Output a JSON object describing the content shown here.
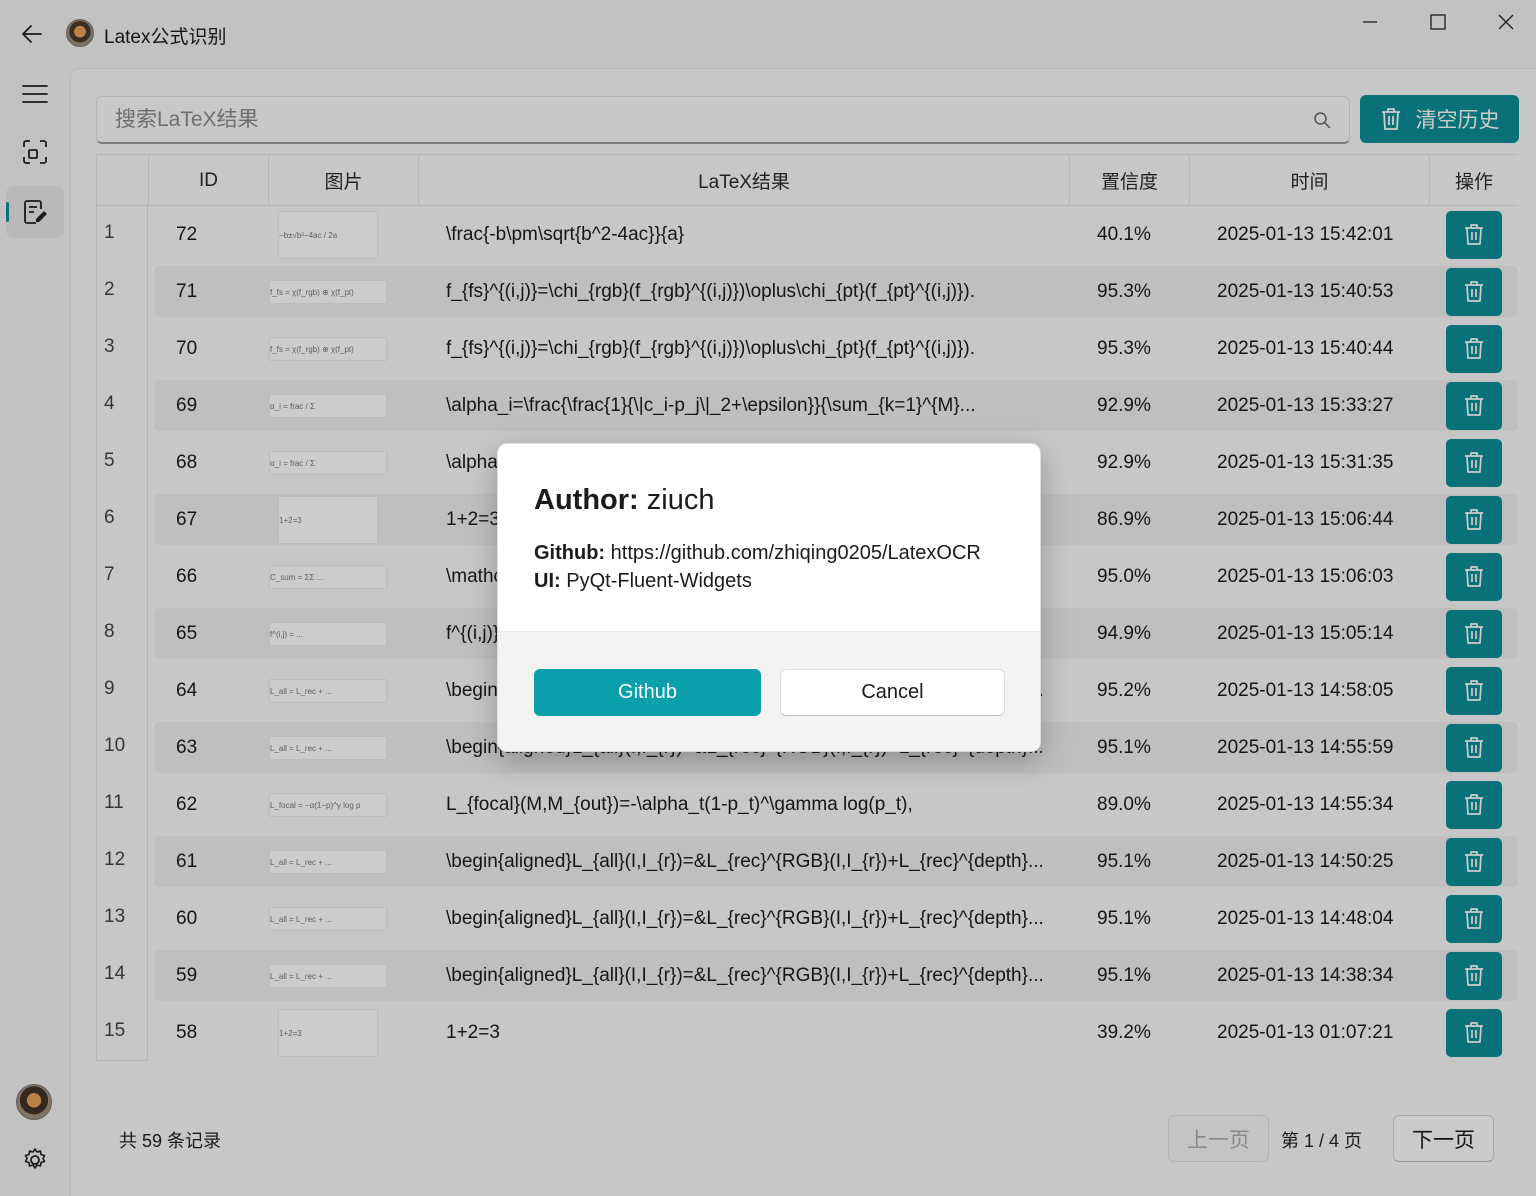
{
  "window": {
    "title": "Latex公式识别",
    "icons": [
      "back-arrow-icon",
      "minimize-icon",
      "maximize-icon",
      "close-icon"
    ]
  },
  "sidebar": {
    "items": [
      {
        "name": "menu",
        "icon": "hamburger-menu-icon"
      },
      {
        "name": "scan",
        "icon": "scan-icon"
      },
      {
        "name": "history",
        "icon": "history-edit-icon",
        "active": true
      }
    ],
    "bottom": [
      {
        "name": "avatar"
      },
      {
        "name": "settings",
        "icon": "gear-icon"
      }
    ]
  },
  "search": {
    "placeholder": "搜索LaTeX结果",
    "value": ""
  },
  "clear_history": {
    "label": "清空历史"
  },
  "table": {
    "headers": [
      "ID",
      "图片",
      "LaTeX结果",
      "置信度",
      "时间",
      "操作"
    ],
    "rows": [
      {
        "n": "1",
        "id": "72",
        "thumb": "−b±√b²−4ac / 2a",
        "latex": "\\frac{-b\\pm\\sqrt{b^2-4ac}}{a}",
        "conf": "40.1%",
        "time": "2025-01-13 15:42:01"
      },
      {
        "n": "2",
        "id": "71",
        "thumb": "f_fs = χ(f_rgb) ⊕ χ(f_pt)",
        "latex": "f_{fs}^{(i,j)}=\\chi_{rgb}(f_{rgb}^{(i,j)})\\oplus\\chi_{pt}(f_{pt}^{(i,j)}).",
        "conf": "95.3%",
        "time": "2025-01-13 15:40:53"
      },
      {
        "n": "3",
        "id": "70",
        "thumb": "f_fs = χ(f_rgb) ⊕ χ(f_pt)",
        "latex": "f_{fs}^{(i,j)}=\\chi_{rgb}(f_{rgb}^{(i,j)})\\oplus\\chi_{pt}(f_{pt}^{(i,j)}).",
        "conf": "95.3%",
        "time": "2025-01-13 15:40:44"
      },
      {
        "n": "4",
        "id": "69",
        "thumb": "α_i = frac / Σ",
        "latex": "\\alpha_i=\\frac{\\frac{1}{\\|c_i-p_j\\|_2+\\epsilon}}{\\sum_{k=1}^{M}...",
        "conf": "92.9%",
        "time": "2025-01-13 15:33:27"
      },
      {
        "n": "5",
        "id": "68",
        "thumb": "α_i = frac / Σ",
        "latex": "\\alpha_i=\\frac{\\frac{1}{\\|c_i-p_j\\|_2+\\epsilon}}{\\sum_{k=1}^{M}...",
        "conf": "92.9%",
        "time": "2025-01-13 15:31:35"
      },
      {
        "n": "6",
        "id": "67",
        "thumb": "1+2=3",
        "latex": "1+2=3",
        "conf": "86.9%",
        "time": "2025-01-13 15:06:44"
      },
      {
        "n": "7",
        "id": "66",
        "thumb": "C_sum = ΣΣ ...",
        "latex": "\\mathcal{C}_{sum}=\\sum_{k=1}^{N}...",
        "conf": "95.0%",
        "time": "2025-01-13 15:06:03"
      },
      {
        "n": "8",
        "id": "65",
        "thumb": "f^(i,j) = ...",
        "latex": "f^{(i,j)}=...",
        "conf": "94.9%",
        "time": "2025-01-13 15:05:14"
      },
      {
        "n": "9",
        "id": "64",
        "thumb": "L_all = L_rec + ...",
        "latex": "\\begin{aligned}L_{all}(I,I_{r})=&L_{rec}^{RGB}(I,I_{r})+L_{rec}^{depth}...",
        "conf": "95.2%",
        "time": "2025-01-13 14:58:05"
      },
      {
        "n": "10",
        "id": "63",
        "thumb": "L_all = L_rec + ...",
        "latex": "\\begin{aligned}L_{all}(I,I_{r})=&L_{rec}^{RGB}(I,I_{r})+L_{rec}^{depth}...",
        "conf": "95.1%",
        "time": "2025-01-13 14:55:59"
      },
      {
        "n": "11",
        "id": "62",
        "thumb": "L_focal = −α(1−p)^γ log p",
        "latex": "L_{focal}(M,M_{out})=-\\alpha_t(1-p_t)^\\gamma log(p_t),",
        "conf": "89.0%",
        "time": "2025-01-13 14:55:34"
      },
      {
        "n": "12",
        "id": "61",
        "thumb": "L_all = L_rec + ...",
        "latex": "\\begin{aligned}L_{all}(I,I_{r})=&L_{rec}^{RGB}(I,I_{r})+L_{rec}^{depth}...",
        "conf": "95.1%",
        "time": "2025-01-13 14:50:25"
      },
      {
        "n": "13",
        "id": "60",
        "thumb": "L_all = L_rec + ...",
        "latex": "\\begin{aligned}L_{all}(I,I_{r})=&L_{rec}^{RGB}(I,I_{r})+L_{rec}^{depth}...",
        "conf": "95.1%",
        "time": "2025-01-13 14:48:04"
      },
      {
        "n": "14",
        "id": "59",
        "thumb": "L_all = L_rec + ...",
        "latex": "\\begin{aligned}L_{all}(I,I_{r})=&L_{rec}^{RGB}(I,I_{r})+L_{rec}^{depth}...",
        "conf": "95.1%",
        "time": "2025-01-13 14:38:34"
      },
      {
        "n": "15",
        "id": "58",
        "thumb": "1+2=3",
        "latex": "1+2=3",
        "conf": "39.2%",
        "time": "2025-01-13 01:07:21"
      }
    ]
  },
  "pagination": {
    "total": "共 59 条记录",
    "prev": "上一页",
    "indicator": "第 1 / 4 页",
    "next": "下一页"
  },
  "dialog": {
    "title_label": "Author:",
    "title_value": "ziuch",
    "github_label": "Github:",
    "github_value": "https://github.com/zhiqing0205/LatexOCR",
    "ui_label": "UI:",
    "ui_value": "PyQt-Fluent-Widgets",
    "primary": "Github",
    "cancel": "Cancel"
  },
  "colors": {
    "accent": "#0a8f96",
    "dialog_primary": "#0aa0ab"
  }
}
